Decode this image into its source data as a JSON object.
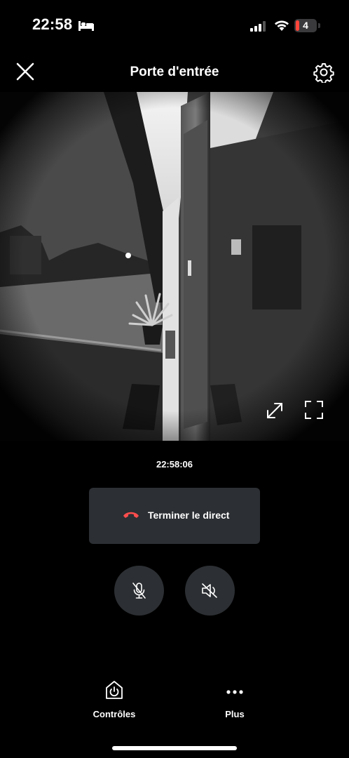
{
  "status_bar": {
    "time": "22:58",
    "battery_level": "4"
  },
  "header": {
    "title": "Porte d'entrée"
  },
  "video": {
    "timestamp": "22:58:06"
  },
  "call": {
    "end_live_label": "Terminer le direct"
  },
  "audio": {
    "mic_muted": true,
    "speaker_muted": true
  },
  "tabs": [
    {
      "label": "Contrôles",
      "icon": "home-power-icon"
    },
    {
      "label": "Plus",
      "icon": "more-dots-icon"
    }
  ],
  "colors": {
    "background": "#000000",
    "button": "#2c2f33",
    "hangup": "#ff4d4d",
    "battery_low": "#ff453a"
  }
}
